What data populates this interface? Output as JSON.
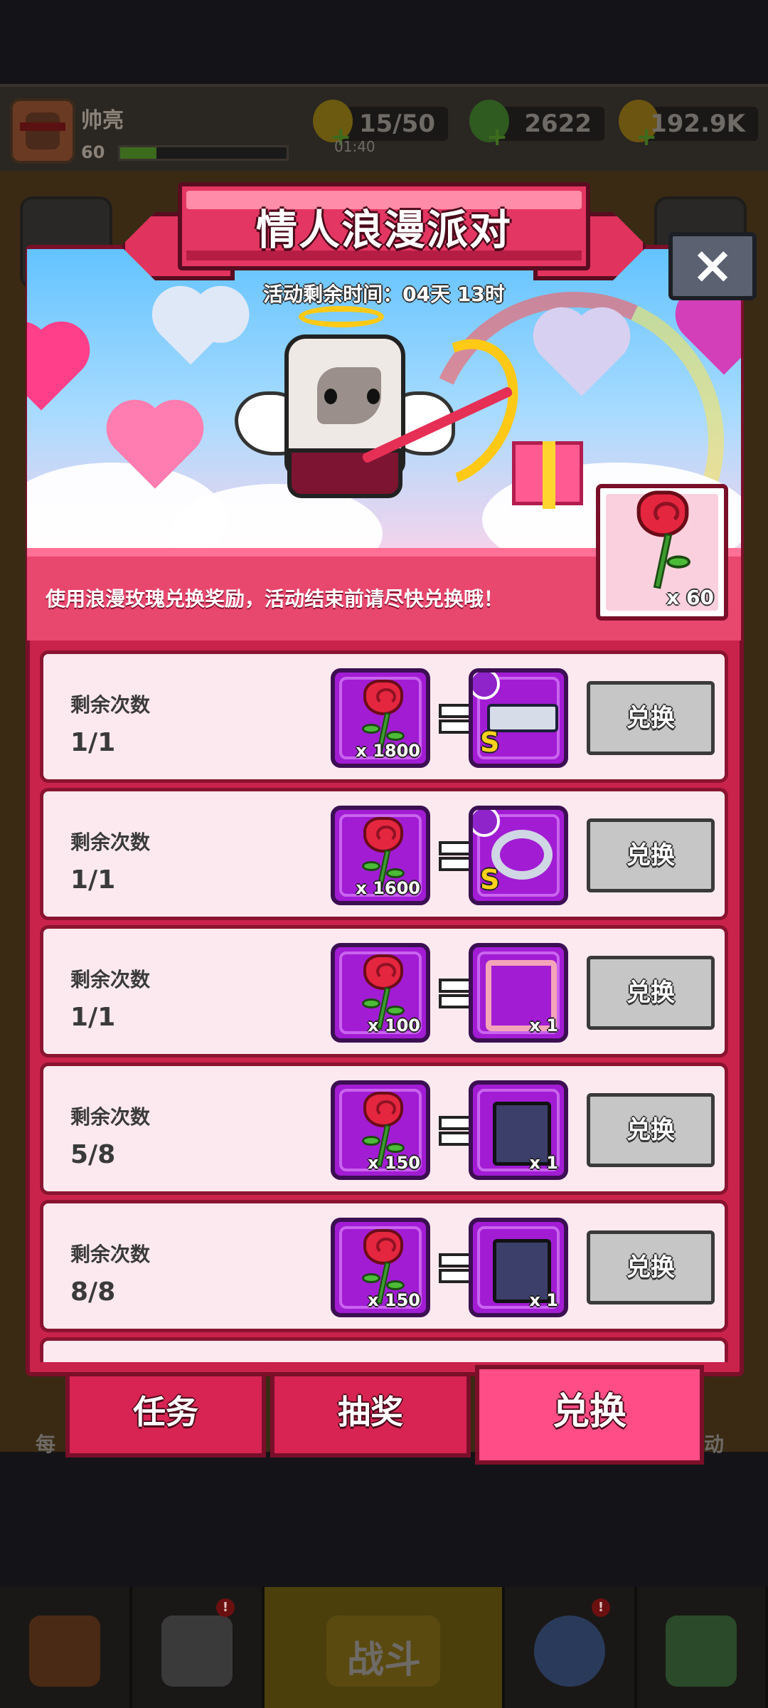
{
  "header": {
    "player_name": "帅亮",
    "level": "60",
    "xp_fraction": 0.22,
    "energy": "15/50",
    "energy_timer": "01:40",
    "gems": "2622",
    "gold": "192.9K"
  },
  "modal": {
    "title": "情人浪漫派对",
    "timer": "活动剩余时间：04天 13时",
    "info": "使用浪漫玫瑰兑换奖励，活动结束前请尽快兑换哦！",
    "rose_count": "x 60",
    "close_icon": "×"
  },
  "rows": [
    {
      "label": "剩余次数",
      "count": "1/1",
      "cost": "x 1800",
      "reward_icon": "gun-icon",
      "reward_grade": "S",
      "reward_qty": "",
      "button": "兑换"
    },
    {
      "label": "剩余次数",
      "count": "1/1",
      "cost": "x 1600",
      "reward_icon": "ring-icon",
      "reward_grade": "S",
      "reward_qty": "",
      "button": "兑换"
    },
    {
      "label": "剩余次数",
      "count": "1/1",
      "cost": "x 100",
      "reward_icon": "frame-icon",
      "reward_grade": "",
      "reward_qty": "x 1",
      "button": "兑换"
    },
    {
      "label": "剩余次数",
      "count": "5/8",
      "cost": "x 150",
      "reward_icon": "weapon-chest-icon",
      "reward_grade": "",
      "reward_qty": "x 1",
      "button": "兑换"
    },
    {
      "label": "剩余次数",
      "count": "8/8",
      "cost": "x 150",
      "reward_icon": "armor-chest-icon",
      "reward_grade": "",
      "reward_qty": "x 1",
      "button": "兑换"
    }
  ],
  "tabs": [
    {
      "label": "任务",
      "active": false
    },
    {
      "label": "抽奖",
      "active": false
    },
    {
      "label": "兑换",
      "active": true
    }
  ],
  "background": {
    "battle_label": "战斗",
    "side_left": "每",
    "side_right": "动",
    "alert_mark": "!"
  },
  "colors": {
    "panel": "#c9234c",
    "row_bg": "#fce9ef",
    "slot": "#a21cd4",
    "tab_active": "#ff4d87",
    "button_disabled": "#c6c6c6"
  }
}
